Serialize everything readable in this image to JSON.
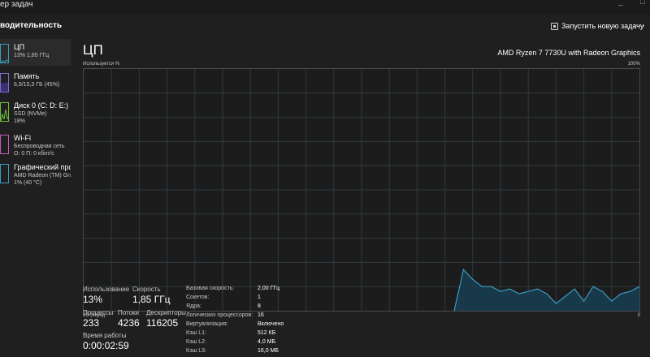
{
  "window": {
    "title": "ер задач",
    "section_title": "водительность",
    "run_task_label": "Запустить новую задачу",
    "more_label": "···"
  },
  "sidebar": {
    "items": [
      {
        "name": "ЦП",
        "sub1": "13% 1,85 ГГц",
        "sub2": "",
        "sub3": "",
        "color": "#3a9bbf",
        "active": true
      },
      {
        "name": "Память",
        "sub1": "6,9/15,3 ГБ (45%)",
        "sub2": "",
        "sub3": "",
        "color": "#7e6ad6",
        "active": false
      },
      {
        "name": "Диск 0 (C: D: E:)",
        "sub1": "SSD (NVMe)",
        "sub2": "18%",
        "sub3": "",
        "color": "#6cbf3a",
        "active": false
      },
      {
        "name": "Wi-Fi",
        "sub1": "Беспроводная сеть",
        "sub2": "О: 0 П: 0 кбит/с",
        "sub3": "",
        "color": "#c25ab8",
        "active": false
      },
      {
        "name": "Графический про",
        "sub1": "AMD Radeon (TM) Grap",
        "sub2": "1% (40 °C)",
        "sub3": "",
        "color": "#3a9bbf",
        "active": false
      }
    ]
  },
  "main": {
    "title": "ЦП",
    "cpu_model": "AMD Ryzen 7 7730U with Radeon Graphics",
    "graph_top_label": "Используется %",
    "graph_max_label": "100%",
    "graph_time_label": "60 секунд",
    "graph_min_label": "0"
  },
  "chart_data": {
    "type": "area",
    "ylim": [
      0,
      100
    ],
    "xlim": [
      60,
      0
    ],
    "x": [
      60,
      59,
      58,
      57,
      56,
      55,
      54,
      53,
      52,
      51,
      50,
      49,
      48,
      47,
      46,
      45,
      44,
      43,
      42,
      41,
      40,
      39,
      38,
      37,
      36,
      35,
      34,
      33,
      32,
      31,
      30,
      29,
      28,
      27,
      26,
      25,
      24,
      23,
      22,
      21,
      20,
      19,
      18,
      17,
      16,
      15,
      14,
      13,
      12,
      11,
      10,
      9,
      8,
      7,
      6,
      5,
      4,
      3,
      2,
      1,
      0
    ],
    "values": [
      0,
      0,
      0,
      0,
      0,
      0,
      0,
      0,
      0,
      0,
      0,
      0,
      0,
      0,
      0,
      0,
      0,
      0,
      0,
      0,
      0,
      0,
      0,
      0,
      0,
      0,
      0,
      0,
      0,
      0,
      0,
      0,
      0,
      0,
      0,
      0,
      0,
      0,
      0,
      0,
      0,
      17,
      13,
      10,
      10,
      8,
      9,
      7,
      8,
      9,
      7,
      3,
      6,
      9,
      4,
      10,
      8,
      4,
      7,
      8,
      10
    ],
    "grid": true,
    "accent": "#3a9bbf"
  },
  "stats": {
    "usage_label": "Использование",
    "usage_value": "13%",
    "speed_label": "Скорость",
    "speed_value": "1,85 ГГц",
    "processes_label": "Процессы",
    "processes_value": "233",
    "threads_label": "Потоки",
    "threads_value": "4236",
    "handles_label": "Дескрипторы",
    "handles_value": "116205",
    "uptime_label": "Время работы",
    "uptime_value": "0:00:02:59"
  },
  "specs": [
    {
      "k": "Базовая скорость:",
      "v": "2,00 ГГц"
    },
    {
      "k": "Сокетов:",
      "v": "1"
    },
    {
      "k": "Ядра:",
      "v": "8"
    },
    {
      "k": "Логических процессоров:",
      "v": "16"
    },
    {
      "k": "Виртуализация:",
      "v": "Включено"
    },
    {
      "k": "Кэш L1:",
      "v": "512 КБ"
    },
    {
      "k": "Кэш L2:",
      "v": "4,0 МБ"
    },
    {
      "k": "Кэш L3:",
      "v": "16,0 МБ"
    }
  ]
}
